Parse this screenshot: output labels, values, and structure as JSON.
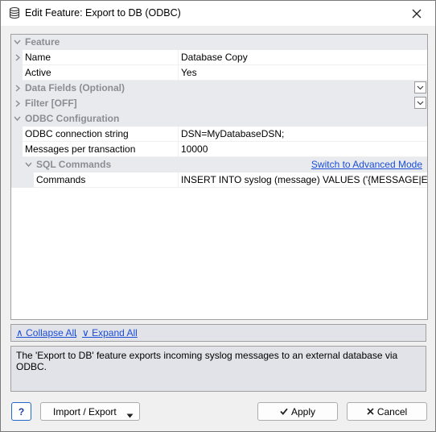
{
  "window": {
    "title": "Edit Feature: Export to DB (ODBC)",
    "title_icon": "database-icon",
    "close_icon": "close-icon"
  },
  "grid": {
    "categories": {
      "feature": "Feature",
      "data_fields": "Data Fields (Optional)",
      "filter": "Filter [OFF]",
      "odbc": "ODBC Configuration",
      "sql": "SQL Commands"
    },
    "props": {
      "name": {
        "label": "Name",
        "value": "Database Copy"
      },
      "active": {
        "label": "Active",
        "value": "Yes"
      },
      "odbc_conn": {
        "label": "ODBC connection string",
        "value": "DSN=MyDatabaseDSN;"
      },
      "msgs_per_tx": {
        "label": "Messages per transaction",
        "value": "10000"
      },
      "commands": {
        "label": "Commands",
        "value": "INSERT INTO syslog (message) VALUES ('{MESSAGE|EscSQL"
      }
    },
    "advanced_mode_link": "Switch to Advanced Mode"
  },
  "command_bar": {
    "collapse_all": "∧ Collapse All",
    "separator": ",",
    "expand_all": "∨ Expand All"
  },
  "description": "The 'Export to DB' feature exports incoming syslog messages to an external database via ODBC.",
  "buttons": {
    "help": "?",
    "import_export": "Import / Export",
    "apply": "Apply",
    "cancel": "Cancel"
  },
  "colors": {
    "category_bg": "#e9eaed",
    "category_text": "#8a8d94",
    "link": "#1a4ed8",
    "panel_bg": "#e1e3e8"
  }
}
